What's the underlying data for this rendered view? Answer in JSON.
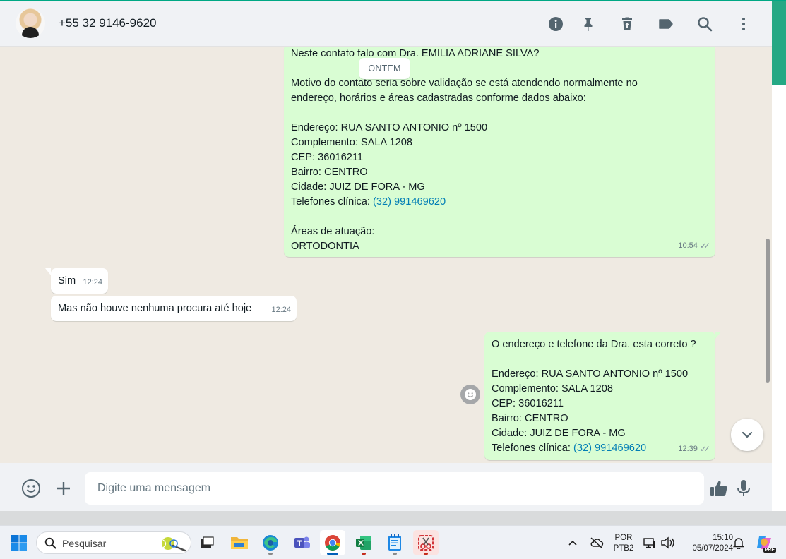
{
  "header": {
    "contact_name": "+55 32 9146-9620",
    "icons": [
      "info-icon",
      "pin-icon",
      "delete-icon",
      "label-icon",
      "search-icon",
      "more-icon"
    ]
  },
  "chat": {
    "date_chip": "ONTEM",
    "messages": [
      {
        "direction": "out",
        "lines": [
          "Neste contato falo com Dra. EMILIA ADRIANE SILVA?",
          "",
          "Motivo do contato seria sobre validação se está atendendo normalmente no",
          "endereço, horários e áreas cadastradas conforme dados abaixo:",
          "",
          "Endereço: RUA SANTO ANTONIO nº 1500",
          "Complemento: SALA 1208",
          "CEP: 36016211",
          "Bairro: CENTRO",
          "Cidade: JUIZ DE FORA - MG"
        ],
        "phone_prefix": "Telefones clínica: ",
        "phone": "(32) 991469620",
        "lines_after": [
          "",
          "Áreas de atuação:",
          "ORTODONTIA"
        ],
        "time": "10:54"
      },
      {
        "direction": "in",
        "text": "Sim",
        "time": "12:24"
      },
      {
        "direction": "in",
        "text": "Mas não houve nenhuma procura até hoje",
        "time": "12:24"
      },
      {
        "direction": "out",
        "lines": [
          "O endereço e telefone da Dra. esta correto ?",
          "",
          "Endereço: RUA SANTO ANTONIO nº 1500",
          "Complemento: SALA 1208",
          "CEP: 36016211",
          "Bairro: CENTRO",
          "Cidade: JUIZ DE FORA - MG"
        ],
        "phone_prefix": "Telefones clínica: ",
        "phone": "(32) 991469620",
        "time": "12:39"
      }
    ]
  },
  "composer": {
    "placeholder": "Digite uma mensagem"
  },
  "taskbar": {
    "search_label": "Pesquisar",
    "lang_line1": "POR",
    "lang_line2": "PTB2",
    "time": "15:10",
    "date": "05/07/2024",
    "copilot_badge": "PRE"
  },
  "colors": {
    "accent": "#00a884",
    "outgoing_bubble": "#d9fdd3",
    "incoming_bubble": "#ffffff",
    "link": "#027eb5"
  }
}
